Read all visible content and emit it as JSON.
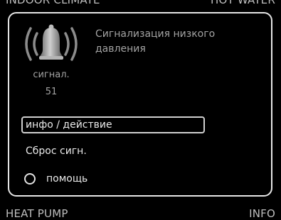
{
  "background_tabs": {
    "top_left": "INDOOR CLIMATE",
    "top_right": "HOT WATER",
    "bottom_left": "HEAT PUMP",
    "bottom_right": "INFO"
  },
  "alarm": {
    "icon": "alarm-bell-icon",
    "title": "Сигнализация низкого давления",
    "caption": "сигнал.",
    "code": "51"
  },
  "menu": {
    "items": [
      {
        "label": "инфо / действие",
        "selected": true
      },
      {
        "label": "Сброс сигн.",
        "selected": false
      }
    ],
    "help_label": "помощь"
  },
  "colors": {
    "background": "#000000",
    "border": "#e6e6e6",
    "text_primary": "#eaeaea",
    "text_secondary": "#a3a3a3"
  }
}
